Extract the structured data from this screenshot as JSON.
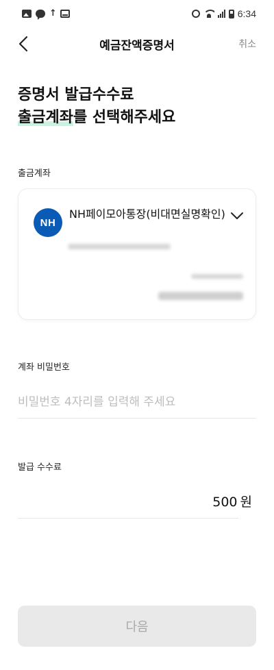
{
  "status_bar": {
    "time": "6:34",
    "left_icons": [
      "gallery-icon",
      "talk-icon",
      "upload-icon",
      "mail-icon"
    ],
    "right_icons": [
      "alarm-icon",
      "wifi-icon",
      "signal-icon",
      "battery-icon"
    ]
  },
  "header": {
    "title": "예금잔액증명서",
    "cancel_label": "취소",
    "back_icon": "chevron-left-icon"
  },
  "headline": {
    "line1": "증명서 발급수수료",
    "line2_highlight": "출금계좌",
    "line2_rest": "를 선택해주세요"
  },
  "withdraw_account": {
    "label": "출금계좌",
    "bank_logo_text": "NH",
    "account_name": "NH페이모아통장(비대면실명확인)",
    "dropdown_icon": "chevron-down-icon",
    "colors": {
      "bank_logo": "#0a5bb5"
    }
  },
  "password": {
    "label": "계좌 비밀번호",
    "placeholder": "비밀번호 4자리를 입력해 주세요",
    "value": ""
  },
  "fee": {
    "label": "발급 수수료",
    "amount": "500",
    "unit": "원"
  },
  "next_button": {
    "label": "다음",
    "enabled": false
  },
  "colors": {
    "highlight": "#c9f2e0",
    "button_disabled_bg": "#e9e9e9",
    "button_disabled_text": "#a8a8a8"
  }
}
